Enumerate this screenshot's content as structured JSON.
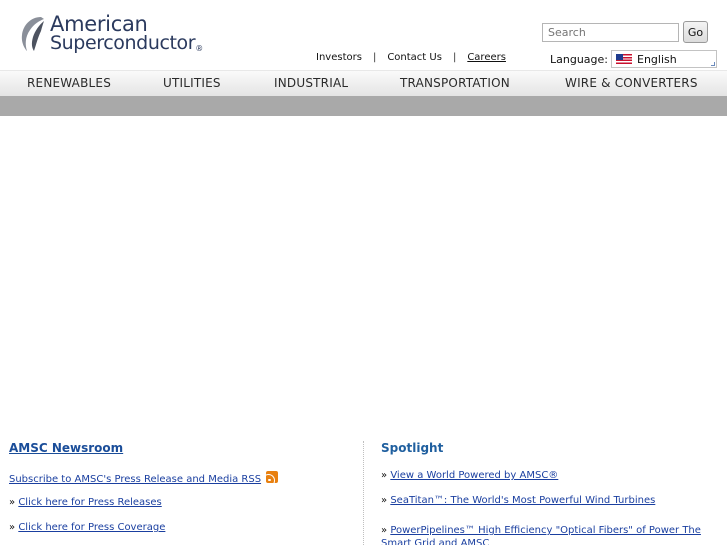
{
  "logo": {
    "line1": "American",
    "line2": "Superconductor",
    "reg": "®"
  },
  "search": {
    "placeholder": "Search",
    "go_label": "Go"
  },
  "utility_links": [
    {
      "label": "Investors"
    },
    {
      "label": "Contact Us"
    },
    {
      "label": "Careers"
    }
  ],
  "separator": "|",
  "language": {
    "label": "Language:",
    "selected": "English"
  },
  "nav": [
    {
      "label": "RENEWABLES"
    },
    {
      "label": "UTILITIES"
    },
    {
      "label": "INDUSTRIAL"
    },
    {
      "label": "TRANSPORTATION"
    },
    {
      "label": "WIRE & CONVERTERS"
    }
  ],
  "newsroom": {
    "title": "AMSC Newsroom",
    "subscribe": "Subscribe to AMSC's Press Release and Media RSS",
    "bullet": "»",
    "links": [
      {
        "label": "Click here for Press Releases"
      },
      {
        "label": "Click here for Press Coverage"
      }
    ]
  },
  "spotlight": {
    "title": "Spotlight",
    "links": [
      {
        "label": "View a World Powered by AMSC®"
      },
      {
        "label": "SeaTitan™: The World's Most Powerful Wind Turbines"
      },
      {
        "label": "PowerPipelines™ High Efficiency \"Optical Fibers\" of Power The Smart Grid and AMSC"
      }
    ]
  },
  "colors": {
    "nav_bg": "#e4e4e4",
    "subbar": "#a9a9a9",
    "link": "#1a3fa0",
    "heading": "#1f5f9f",
    "rss": "#e8800f"
  }
}
